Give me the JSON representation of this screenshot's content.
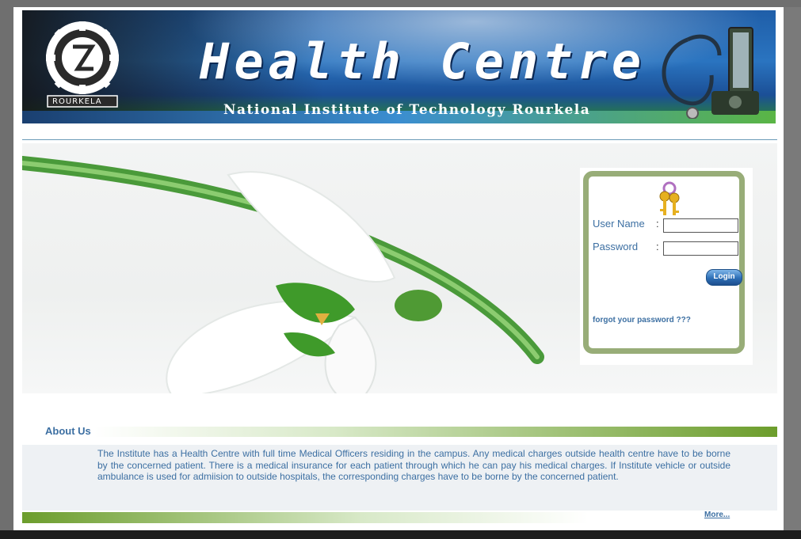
{
  "header": {
    "title": "Health Centre",
    "subtitle": "National Institute of Technology Rourkela",
    "logo_text": "ROURKELA",
    "logo_ring_text": "NATIONAL INSTITUTE OF TECHNOLOGY"
  },
  "login": {
    "username_label": "User Name",
    "password_label": "Password",
    "colon": ":",
    "username_value": "",
    "password_value": "",
    "login_button": "Login",
    "forgot_link": "forgot your password ???"
  },
  "about": {
    "heading": "About Us",
    "body": "The Institute has a Health Centre with full time Medical Officers residing in the campus. Any medical charges outside  health centre have to be borne by the concerned patient. There is a medical insurance for each patient through which he can pay his medical charges. If Institute vehicle or outside  ambulance is used for  admiision to outside hospitals, the corresponding  charges have to be borne by the concerned patient.",
    "more_link": "More..."
  },
  "colors": {
    "link_blue": "#3c6fa2",
    "login_border": "#98ad78",
    "bar_green": "#6c9d2c"
  },
  "icons": [
    "keys-icon",
    "stethoscope-icon",
    "nit-logo"
  ]
}
